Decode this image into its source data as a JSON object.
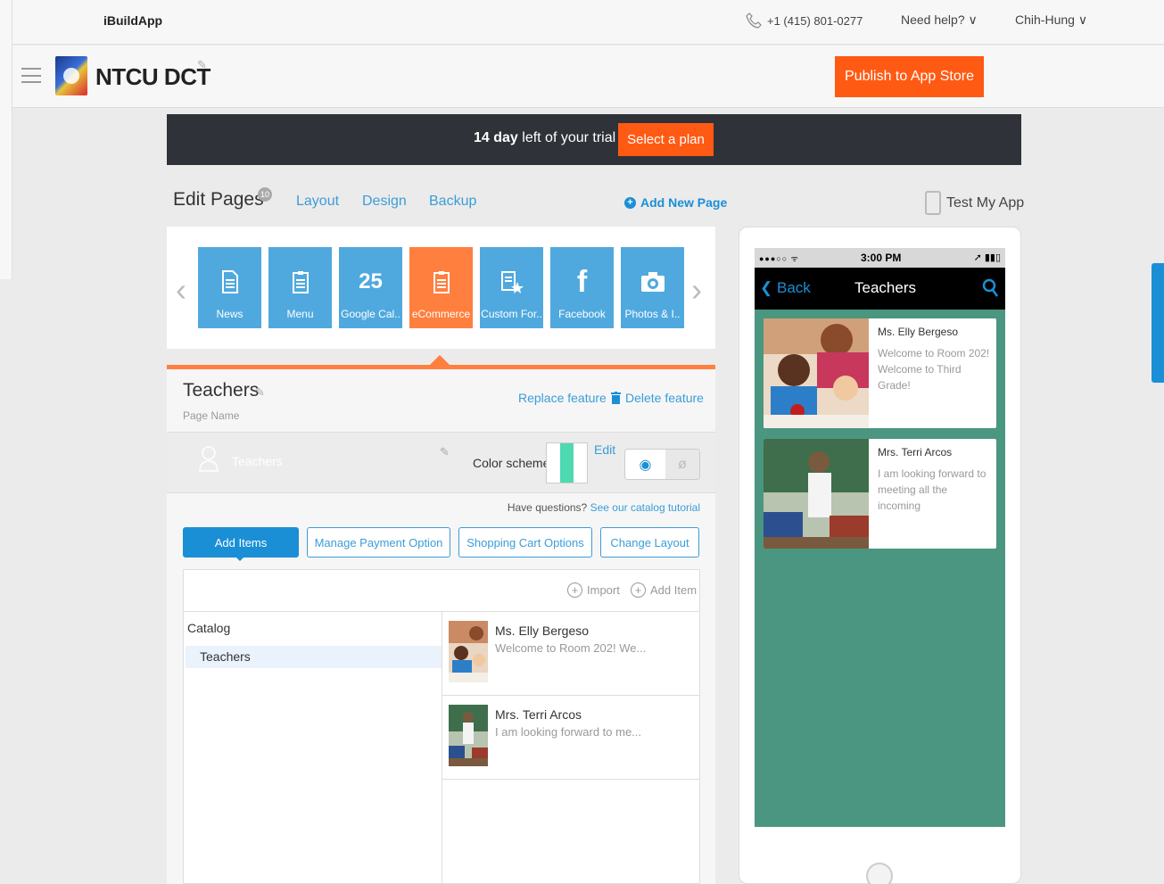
{
  "topbar": {
    "brand": "iBuildApp",
    "phone": "+1 (415) 801-0277",
    "help": "Need help? ∨",
    "user": "Chih-Hung ∨"
  },
  "appbar": {
    "app_name": "NTCU DCT",
    "publish_label": "Publish to App Store"
  },
  "trial": {
    "days_bold": "14 day",
    "text": " left of your trial",
    "plan_label": "Select a plan"
  },
  "nav": {
    "title": "Edit Pages",
    "badge": "10",
    "links": [
      "Layout",
      "Design",
      "Backup"
    ],
    "add_page": "Add New Page",
    "test_app": "Test My App"
  },
  "page_tiles": [
    {
      "label": "News",
      "icon": "document-icon"
    },
    {
      "label": "Menu",
      "icon": "clipboard-icon"
    },
    {
      "label": "Google Cal..",
      "icon": "calendar-icon",
      "glyph": "25"
    },
    {
      "label": "eCommerce",
      "icon": "clipboard-icon",
      "active": true
    },
    {
      "label": "Custom For..",
      "icon": "form-star-icon"
    },
    {
      "label": "Facebook",
      "icon": "facebook-icon",
      "glyph": "f"
    },
    {
      "label": "Photos & I..",
      "icon": "camera-icon"
    }
  ],
  "page_detail": {
    "title": "Teachers",
    "subtitle": "Page Name",
    "replace": "Replace feature",
    "delete": "Delete feature",
    "bg_text": "Teachers",
    "color_scheme_label": "Color scheme",
    "color_scheme_edit": "Edit",
    "swatch_colors": [
      "#ffffff",
      "#4fd9b0",
      "#ffffff"
    ],
    "questions_text": "Have questions? ",
    "questions_link": "See our catalog tutorial"
  },
  "tabs": [
    "Add Items",
    "Manage Payment Option",
    "Shopping Cart Options",
    "Change Layout"
  ],
  "items_panel": {
    "import_label": "Import",
    "add_item_label": "Add Item",
    "catalog_label": "Catalog",
    "category": "Teachers",
    "items": [
      {
        "name": "Ms. Elly Bergeso",
        "desc": "Welcome to Room 202! We..."
      },
      {
        "name": "Mrs. Terri Arcos",
        "desc": "I am looking forward to me..."
      }
    ]
  },
  "preview": {
    "carrier": "●●●○○ ᯤ",
    "time": "3:00 PM",
    "battery": "➚ ▮▮▯",
    "back": "Back",
    "title": "Teachers",
    "cards": [
      {
        "name": "Ms. Elly Bergeso",
        "desc": "Welcome to Room 202! Welcome to Third Grade!"
      },
      {
        "name": "Mrs. Terri Arcos",
        "desc": "I am looking forward to meeting all the incoming"
      }
    ]
  },
  "colors": {
    "accent_orange": "#ff5a14",
    "tile_blue": "#4fa9de",
    "link_blue": "#3b9dd8",
    "phone_bg": "#4a9680"
  }
}
